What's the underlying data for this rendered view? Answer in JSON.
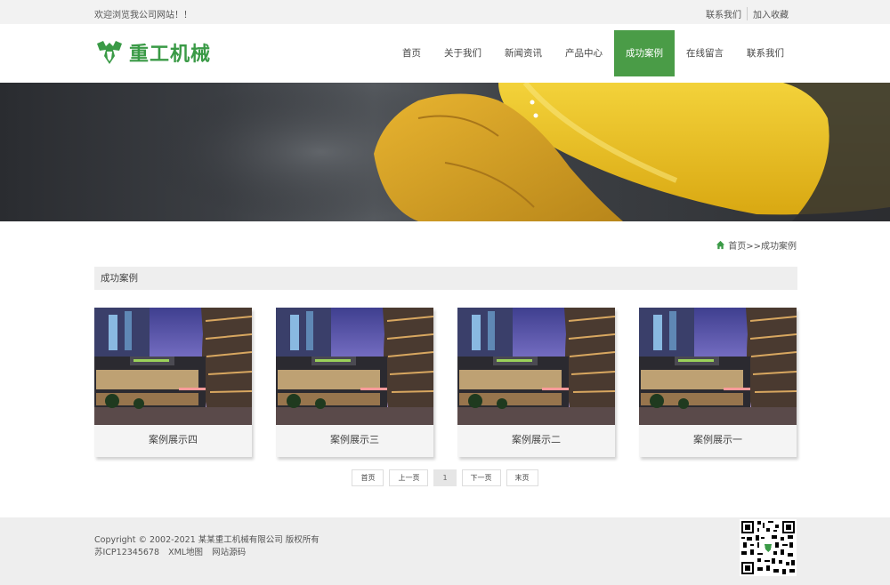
{
  "topbar": {
    "welcome": "欢迎浏览我公司网站！！",
    "links": [
      "联系我们",
      "加入收藏"
    ]
  },
  "header": {
    "logo_text": "重工机械",
    "logo_icon": "leaf-gear-logo",
    "brand_color": "#3a9a46",
    "nav": [
      {
        "label": "首页",
        "active": false
      },
      {
        "label": "关于我们",
        "active": false
      },
      {
        "label": "新闻资讯",
        "active": false
      },
      {
        "label": "产品中心",
        "active": false
      },
      {
        "label": "成功案例",
        "active": true
      },
      {
        "label": "在线留言",
        "active": false
      },
      {
        "label": "联系我们",
        "active": false
      }
    ],
    "active_color": "#4a9c47"
  },
  "banner": {
    "image": "worker-holding-yellow-hardhat"
  },
  "breadcrumb": {
    "icon": "home-icon",
    "text": "首页>>成功案例"
  },
  "section": {
    "title": "成功案例"
  },
  "cases": [
    {
      "caption": "案例展示四",
      "image": "building-street-night"
    },
    {
      "caption": "案例展示三",
      "image": "building-street-night"
    },
    {
      "caption": "案例展示二",
      "image": "building-street-night"
    },
    {
      "caption": "案例展示一",
      "image": "building-street-night"
    }
  ],
  "pagination": {
    "first": "首页",
    "prev": "上一页",
    "current": "1",
    "next": "下一页",
    "last": "末页"
  },
  "footer": {
    "copyright": "Copyright © 2002-2021 某某重工机械有限公司 版权所有",
    "icp": "苏ICP12345678",
    "xml": "XML地图",
    "source": "网站源码",
    "qr_icon": "qr-code-icon"
  }
}
